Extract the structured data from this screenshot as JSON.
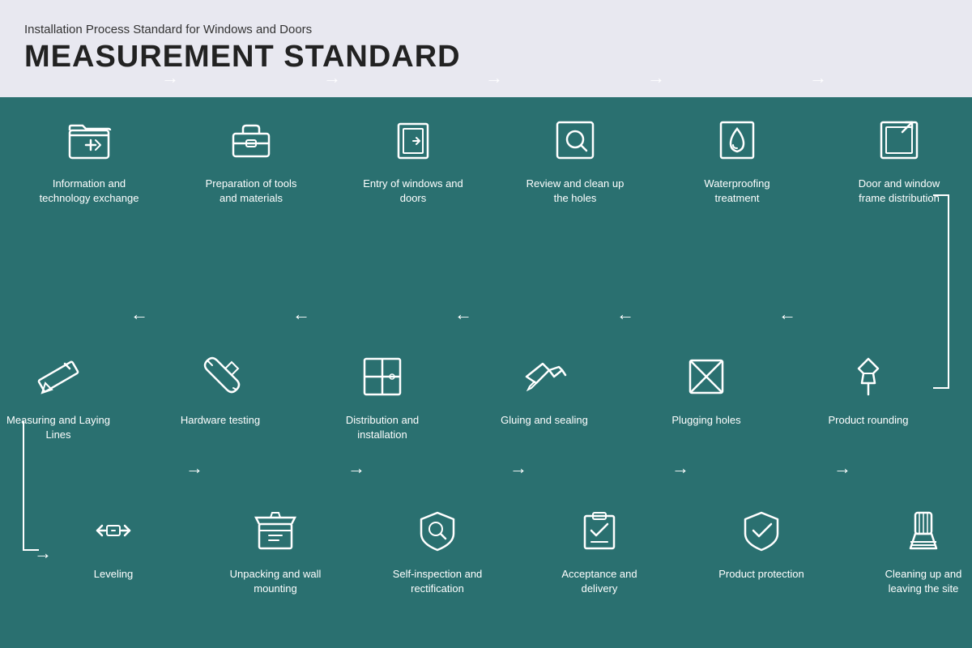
{
  "header": {
    "subtitle": "Installation Process Standard for Windows and Doors",
    "title": "MEASUREMENT STANDARD"
  },
  "row1": {
    "steps": [
      {
        "id": "info-tech",
        "label": "Information and technology exchange",
        "icon": "folder"
      },
      {
        "id": "prep-tools",
        "label": "Preparation of tools and materials",
        "icon": "toolbox"
      },
      {
        "id": "entry-windows",
        "label": "Entry of windows and doors",
        "icon": "door-entry"
      },
      {
        "id": "review-holes",
        "label": "Review and clean up the holes",
        "icon": "search-box"
      },
      {
        "id": "waterproofing",
        "label": "Waterproofing treatment",
        "icon": "water-drop"
      },
      {
        "id": "frame-dist",
        "label": "Door and window frame distribution",
        "icon": "frame-export"
      }
    ]
  },
  "row2": {
    "steps": [
      {
        "id": "measuring",
        "label": "Measuring and Laying Lines",
        "icon": "ruler-pencil"
      },
      {
        "id": "hardware",
        "label": "Hardware testing",
        "icon": "wrench-tools"
      },
      {
        "id": "distribution",
        "label": "Distribution and installation",
        "icon": "grid-install"
      },
      {
        "id": "gluing",
        "label": "Gluing and sealing",
        "icon": "caulk-gun"
      },
      {
        "id": "plugging",
        "label": "Plugging holes",
        "icon": "plug-hole"
      },
      {
        "id": "product-round",
        "label": "Product rounding",
        "icon": "pin-tack"
      }
    ]
  },
  "row3": {
    "steps": [
      {
        "id": "leveling",
        "label": "Leveling",
        "icon": "level"
      },
      {
        "id": "unpacking",
        "label": "Unpacking and wall mounting",
        "icon": "unpack"
      },
      {
        "id": "self-inspect",
        "label": "Self-inspection and rectification",
        "icon": "inspect-search"
      },
      {
        "id": "acceptance",
        "label": "Acceptance and delivery",
        "icon": "accept-check"
      },
      {
        "id": "protection",
        "label": "Product protection",
        "icon": "shield-check"
      },
      {
        "id": "cleanup",
        "label": "Cleaning up and leaving the site",
        "icon": "broom"
      }
    ]
  },
  "colors": {
    "bg_main": "#2a7070",
    "bg_header": "#e8e8f0",
    "text_white": "#ffffff",
    "text_dark": "#222222"
  }
}
